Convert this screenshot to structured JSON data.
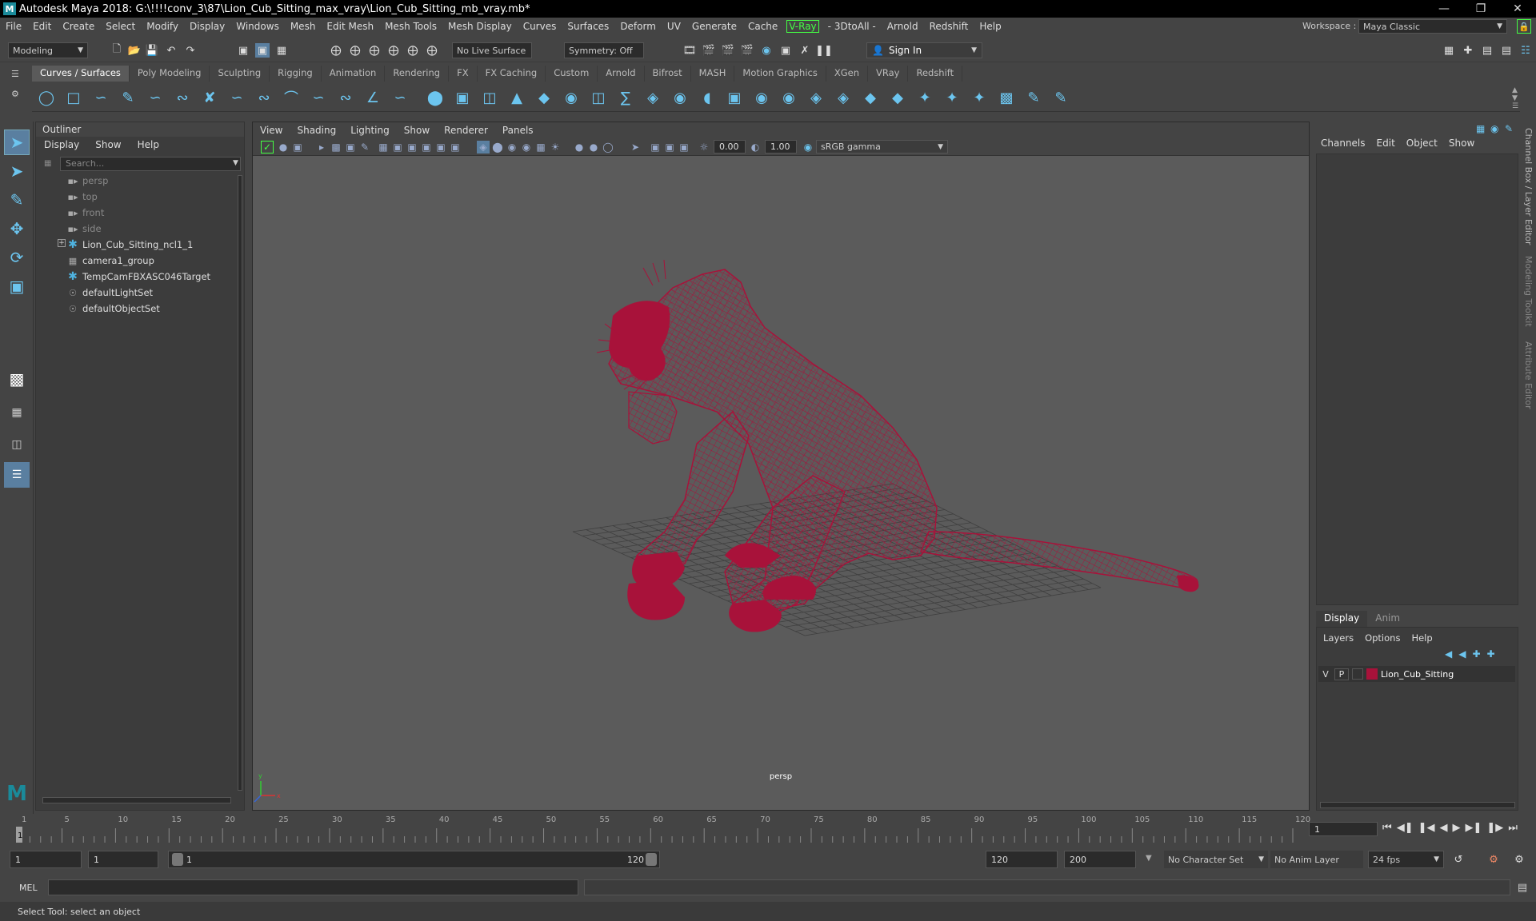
{
  "window": {
    "title": "Autodesk Maya 2018: G:\\!!!!conv_3\\87\\Lion_Cub_Sitting_max_vray\\Lion_Cub_Sitting_mb_vray.mb*",
    "logo": "M"
  },
  "menubar": [
    "File",
    "Edit",
    "Create",
    "Select",
    "Modify",
    "Display",
    "Windows",
    "Mesh",
    "Edit Mesh",
    "Mesh Tools",
    "Mesh Display",
    "Curves",
    "Surfaces",
    "Deform",
    "UV",
    "Generate",
    "Cache",
    "V-Ray",
    "- 3DtoAll -",
    "Arnold",
    "Redshift",
    "Help"
  ],
  "workspace": {
    "label": "Workspace :",
    "value": "Maya Classic"
  },
  "toolbar": {
    "mode": "Modeling",
    "live_surface": "No Live Surface",
    "symmetry": "Symmetry: Off",
    "sign_in": "Sign In"
  },
  "shelf_tabs": [
    "Curves / Surfaces",
    "Poly Modeling",
    "Sculpting",
    "Rigging",
    "Animation",
    "Rendering",
    "FX",
    "FX Caching",
    "Custom",
    "Arnold",
    "Bifrost",
    "MASH",
    "Motion Graphics",
    "XGen",
    "VRay",
    "Redshift"
  ],
  "outliner": {
    "title": "Outliner",
    "menu": [
      "Display",
      "Show",
      "Help"
    ],
    "search_placeholder": "Search...",
    "items": [
      {
        "name": "persp",
        "icon": "camera-icon",
        "dim": true
      },
      {
        "name": "top",
        "icon": "camera-icon",
        "dim": true
      },
      {
        "name": "front",
        "icon": "camera-icon",
        "dim": true
      },
      {
        "name": "side",
        "icon": "camera-icon",
        "dim": true
      },
      {
        "name": "Lion_Cub_Sitting_ncl1_1",
        "icon": "joint-icon",
        "dim": false
      },
      {
        "name": "camera1_group",
        "icon": "group-icon",
        "dim": false
      },
      {
        "name": "TempCamFBXASC046Target",
        "icon": "joint-icon",
        "dim": false
      },
      {
        "name": "defaultLightSet",
        "icon": "set-icon",
        "dim": false
      },
      {
        "name": "defaultObjectSet",
        "icon": "set-icon",
        "dim": false
      }
    ]
  },
  "viewport": {
    "menu": [
      "View",
      "Shading",
      "Lighting",
      "Show",
      "Renderer",
      "Panels"
    ],
    "exposure": "0.00",
    "gamma": "1.00",
    "colorspace": "sRGB gamma",
    "camera_label": "persp",
    "wire_color": "#a8123a"
  },
  "channelbox": {
    "menu": [
      "Channels",
      "Edit",
      "Object",
      "Show"
    ]
  },
  "layers": {
    "tabs": [
      "Display",
      "Anim"
    ],
    "menu": [
      "Layers",
      "Options",
      "Help"
    ],
    "rows": [
      {
        "v": "V",
        "p": "P",
        "name": "Lion_Cub_Sitting",
        "color": "#a8123a"
      }
    ]
  },
  "side_tabs": [
    "Channel Box / Layer Editor",
    "Modeling Toolkit",
    "Attribute Editor"
  ],
  "timeline": {
    "ticks": [
      "1",
      "5",
      "10",
      "15",
      "20",
      "25",
      "30",
      "35",
      "40",
      "45",
      "50",
      "55",
      "60",
      "65",
      "70",
      "75",
      "80",
      "85",
      "90",
      "95",
      "100",
      "105",
      "110",
      "115",
      "120"
    ],
    "current_frame": "1"
  },
  "range": {
    "start": "1",
    "playback_start": "1",
    "slider_start": "1",
    "slider_end": "120",
    "playback_end": "120",
    "end": "200",
    "character_set": "No Character Set",
    "anim_layer": "No Anim Layer",
    "fps": "24 fps"
  },
  "cmdline": {
    "lang": "MEL"
  },
  "helpline": "Select Tool: select an object"
}
